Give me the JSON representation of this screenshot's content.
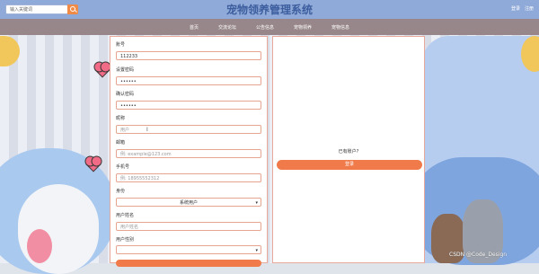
{
  "header": {
    "search_placeholder": "输入关键词",
    "title": "宠物领养管理系统",
    "login": "登录",
    "register": "注册"
  },
  "nav": [
    "首页",
    "交流论坛",
    "公告信息",
    "宠物领养",
    "宠物信息"
  ],
  "form": {
    "fields": [
      {
        "label": "账号",
        "value": "112233",
        "placeholder": ""
      },
      {
        "label": "设置密码",
        "value": "••••••",
        "placeholder": ""
      },
      {
        "label": "确认密码",
        "value": "••••••",
        "placeholder": ""
      },
      {
        "label": "昵称",
        "value": "",
        "placeholder": "用户"
      },
      {
        "label": "邮箱",
        "value": "",
        "placeholder": "例: example@123.com"
      },
      {
        "label": "手机号",
        "value": "",
        "placeholder": "例: 18955552312"
      },
      {
        "label": "身份",
        "value": "系统用户",
        "placeholder": ""
      },
      {
        "label": "用户姓名",
        "value": "",
        "placeholder": "用户姓名"
      },
      {
        "label": "用户性别",
        "value": "",
        "placeholder": ""
      }
    ]
  },
  "login_panel": {
    "have_account": "已有账户?",
    "login_button": "登录"
  },
  "watermark": "CSDN @Code_Design",
  "colors": {
    "accent": "#f07a4a",
    "nav_bg": "#98878a",
    "topbar": "#8fa9d8"
  }
}
